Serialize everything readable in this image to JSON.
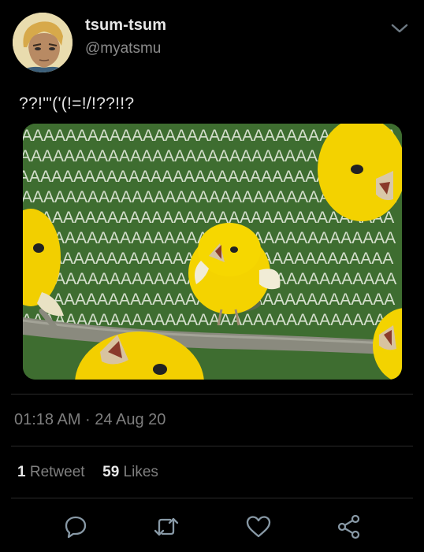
{
  "tweet": {
    "display_name": "tsum-tsum",
    "handle": "@myatsmu",
    "text": "??!'\"('(!=!/!??!!?",
    "timestamp": "01:18 AM · 24 Aug 20",
    "retweets_count": "1",
    "retweets_label": "Retweet",
    "likes_count": "59",
    "likes_label": "Likes"
  },
  "media": {
    "pattern_text": "AAAAAAAAAAAAAAAAAAAAAAAAAAAAAAAAAA"
  },
  "actions": [
    "reply-icon",
    "retweet-icon",
    "like-icon",
    "share-icon"
  ],
  "colors": {
    "background": "#000000",
    "text_primary": "#e7e7e7",
    "text_secondary": "#7e7e7e",
    "icon": "#8899a6",
    "media_green": "#3d6b2f",
    "bird_yellow": "#f2d400"
  }
}
